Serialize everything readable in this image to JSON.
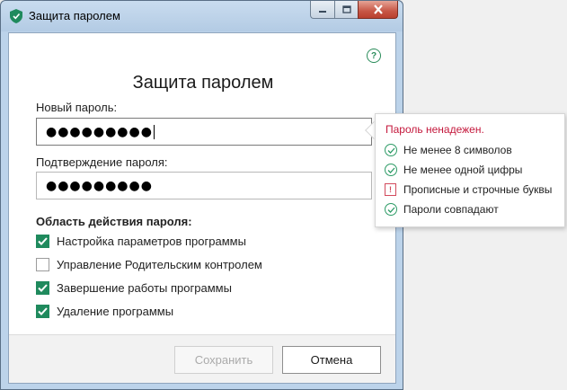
{
  "window": {
    "title": "Защита паролем"
  },
  "dialog": {
    "heading": "Защита паролем",
    "new_password": {
      "label": "Новый пароль:",
      "value": "●●●●●●●●●"
    },
    "confirm_password": {
      "label": "Подтверждение пароля:",
      "value": "●●●●●●●●●"
    },
    "scope": {
      "label": "Область действия пароля:",
      "items": [
        {
          "label": "Настройка параметров программы",
          "checked": true
        },
        {
          "label": "Управление Родительским контролем",
          "checked": false
        },
        {
          "label": "Завершение работы программы",
          "checked": true
        },
        {
          "label": "Удаление программы",
          "checked": true
        }
      ]
    },
    "buttons": {
      "save_label": "Сохранить",
      "cancel_label": "Отмена"
    },
    "help_symbol": "?"
  },
  "tooltip": {
    "title": "Пароль ненадежен.",
    "rules": [
      {
        "text": "Не менее 8 символов",
        "status": "ok"
      },
      {
        "text": "Не менее одной цифры",
        "status": "ok"
      },
      {
        "text": "Прописные и строчные буквы",
        "status": "fail"
      },
      {
        "text": "Пароли совпадают",
        "status": "ok"
      }
    ]
  },
  "colors": {
    "accent_green": "#1f8a5d",
    "warning_red": "#c4183c",
    "titlebar": "#c9dcef"
  },
  "icons": {
    "app": "kaspersky-shield-icon",
    "help": "question-circle-icon",
    "check": "check-circle-icon",
    "warn": "exclamation-box-icon"
  }
}
